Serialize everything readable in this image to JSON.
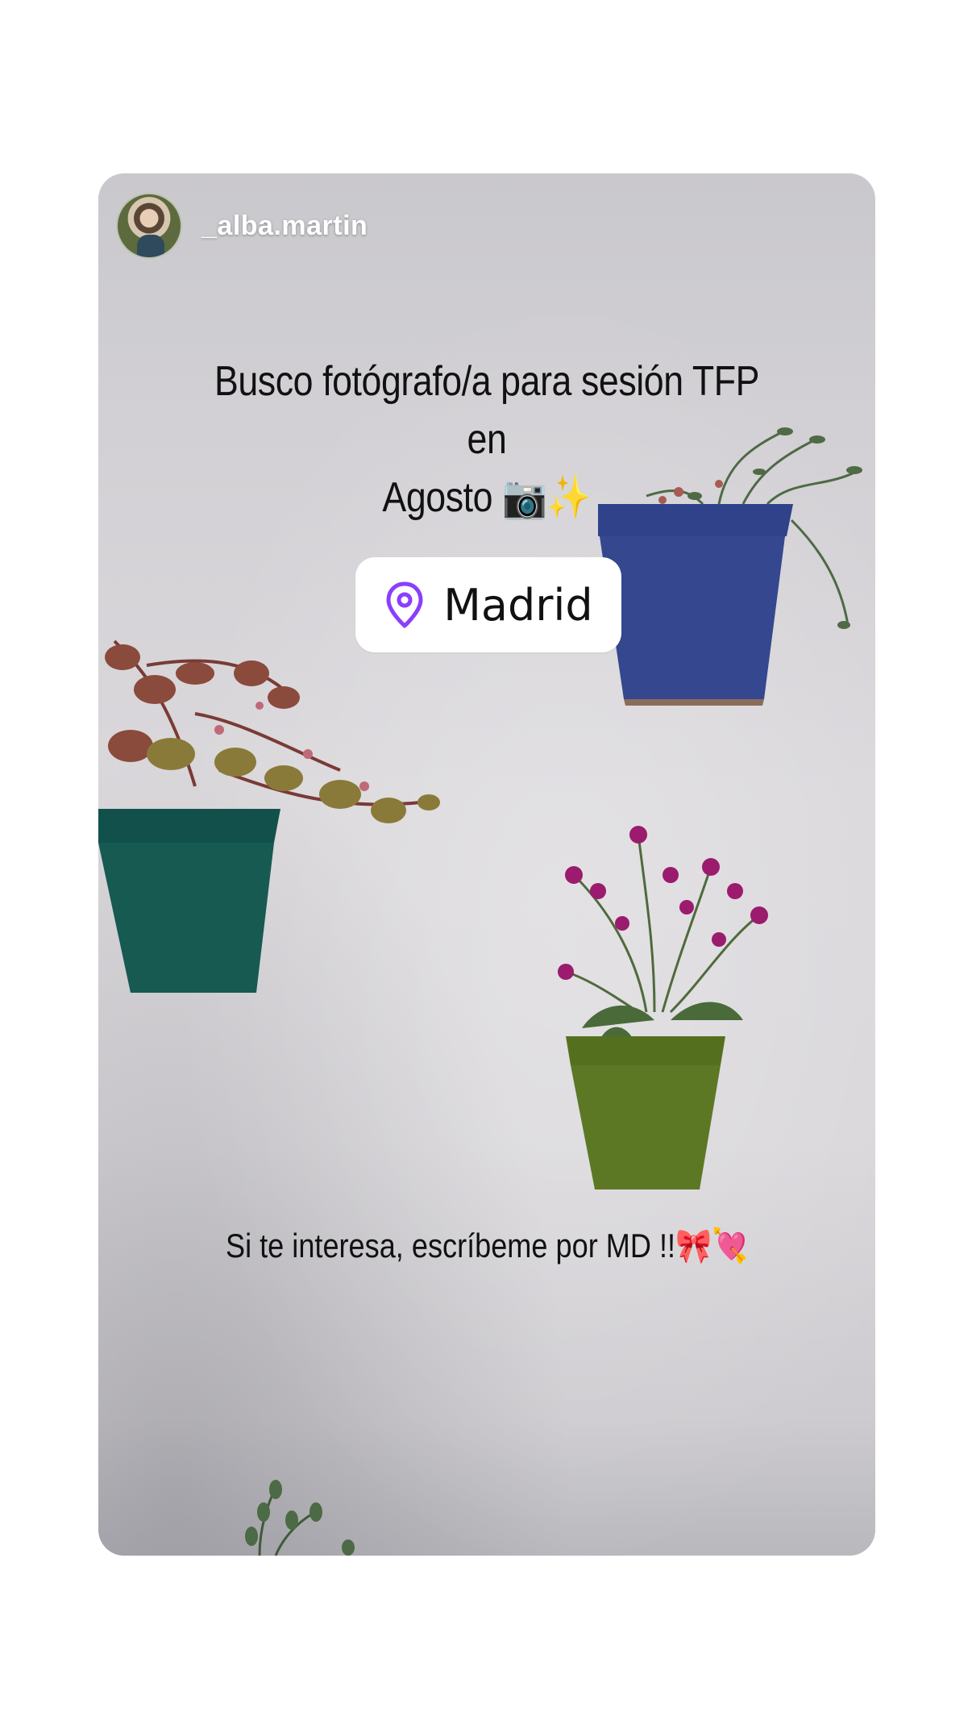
{
  "story": {
    "username": "_alba.martin",
    "headline_line1": "Busco fotógrafo/a para sesión TFP en",
    "headline_line2": "Agosto",
    "headline_emojis": "📷✨",
    "location": "Madrid",
    "footer_text": "Si te interesa, escríbeme por MD !!",
    "footer_emojis": "🎀💘"
  },
  "icons": {
    "location": "map-pin-icon"
  },
  "colors": {
    "pin": "#8a3ffc",
    "pot_blue": "#33468d",
    "pot_teal": "#14574f",
    "pot_green": "#5a7524",
    "flowers": "#9b1b6e"
  }
}
